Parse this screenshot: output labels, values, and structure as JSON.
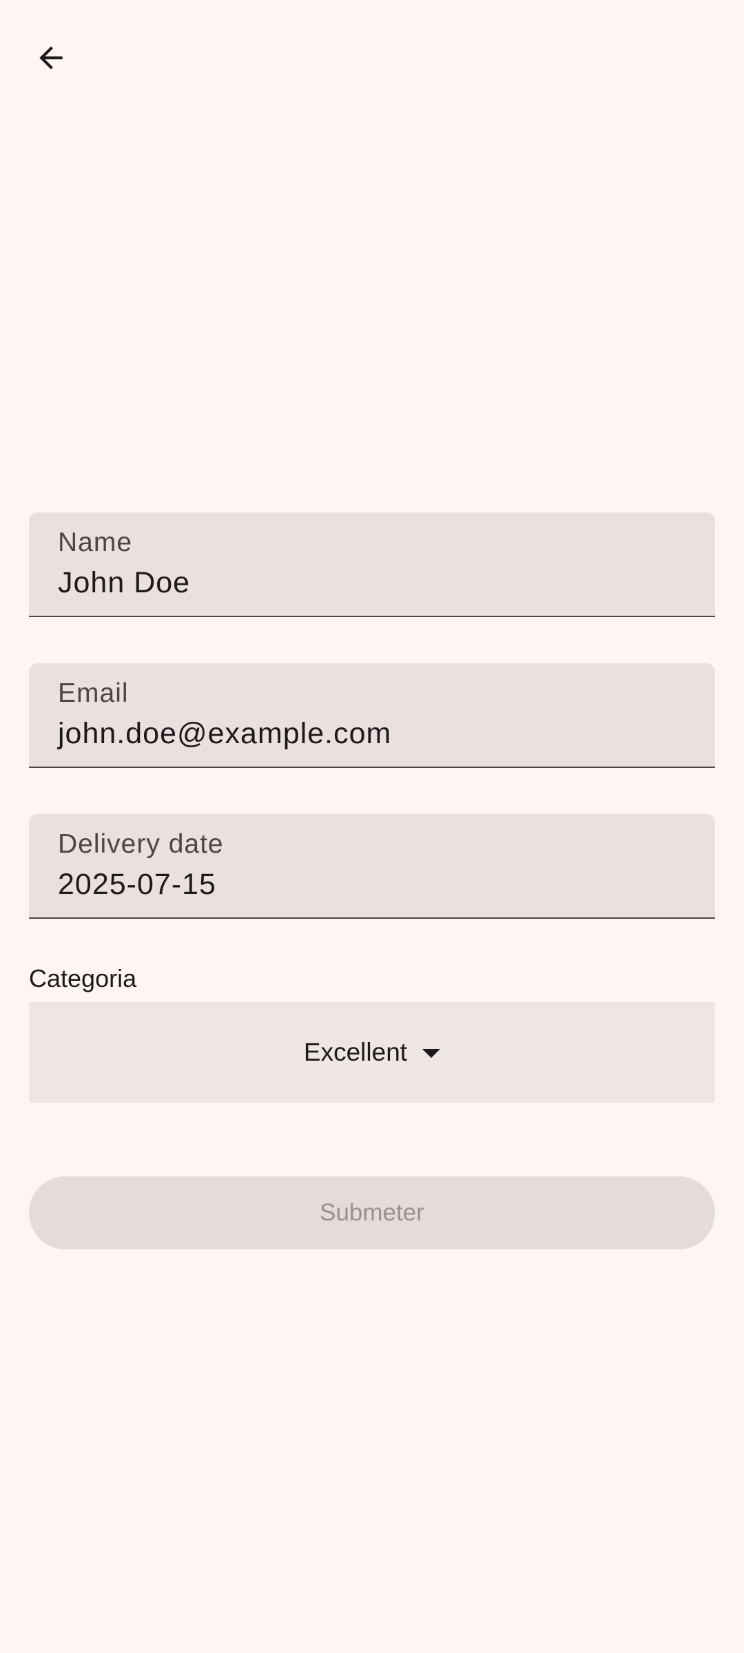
{
  "toolbar": {
    "back_icon": "arrow-back-icon"
  },
  "form": {
    "name": {
      "label": "Name",
      "value": "John Doe"
    },
    "email": {
      "label": "Email",
      "value": "john.doe@example.com"
    },
    "delivery_date": {
      "label": "Delivery date",
      "value": "2025-07-15"
    },
    "category": {
      "label": "Categoria",
      "selected": "Excellent",
      "caret_icon": "dropdown-caret-icon"
    },
    "submit": {
      "label": "Submeter",
      "enabled": false
    }
  },
  "colors": {
    "background": "#fff5f3",
    "field_fill": "#e9e0df",
    "dropdown_fill": "#ede6e3",
    "button_disabled_fill": "#e3dcd9",
    "button_disabled_text": "#9a9290"
  }
}
